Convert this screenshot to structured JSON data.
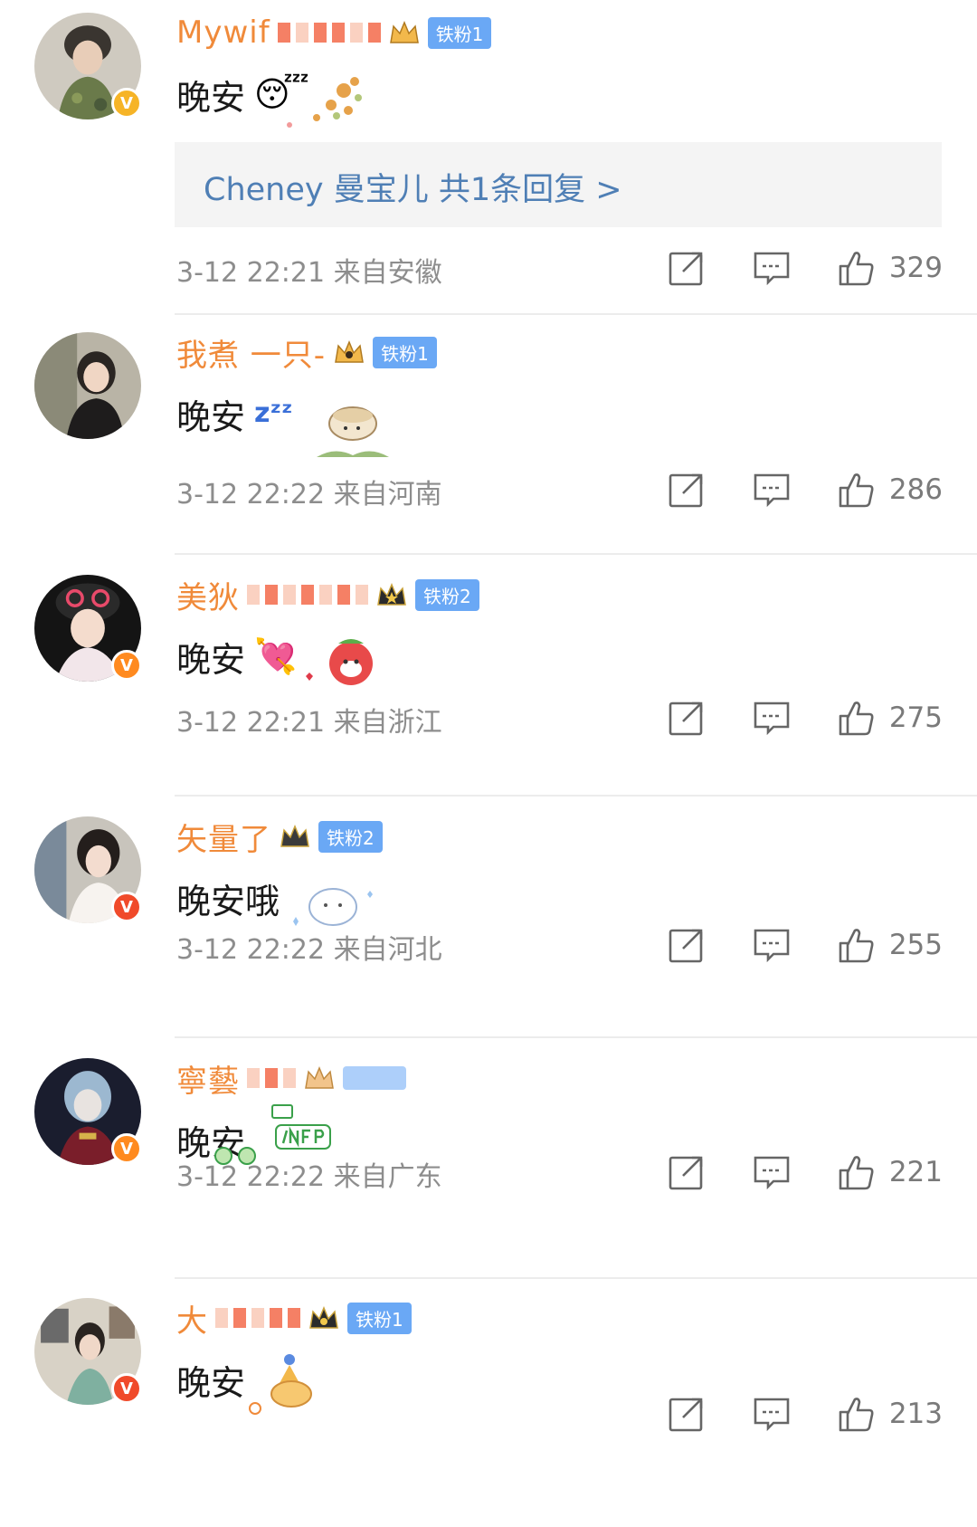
{
  "comments": [
    {
      "name": "Mywif",
      "fan_badge": "铁粉1",
      "text": "晚安",
      "emoji": "😴",
      "verify_color": "#f6b427",
      "replies": "Cheney 曼宝儿  共1条回复 >",
      "time": "3-12 22:21",
      "location": "来自安徽",
      "likes": "329"
    },
    {
      "name": "我煮 一只-",
      "fan_badge": "铁粉1",
      "text": "晚安",
      "emoji": "zᶻᶻ",
      "verify_color": "",
      "time": "3-12 22:22",
      "location": "来自河南",
      "likes": "286"
    },
    {
      "name": "美狄",
      "fan_badge": "铁粉2",
      "text": "晚安",
      "emoji": "💘",
      "verify_color": "#ff8a1f",
      "time": "3-12 22:21",
      "location": "来自浙江",
      "likes": "275"
    },
    {
      "name": "矢量了",
      "fan_badge": "铁粉2",
      "text": "晚安哦",
      "emoji": "",
      "verify_color": "#f04a2a",
      "time": "3-12 22:22",
      "location": "来自河北",
      "likes": "255"
    },
    {
      "name": "寧藝",
      "fan_badge": "",
      "text": "晚安",
      "emoji": "",
      "verify_color": "#ff8a1f",
      "time": "3-12 22:22",
      "location": "来自广东",
      "likes": "221"
    },
    {
      "name": "大",
      "fan_badge": "铁粉1",
      "text": "晚安",
      "emoji": "",
      "verify_color": "#f04a2a",
      "time": "",
      "location": "",
      "likes": "213"
    }
  ],
  "icons": {
    "share": "share-icon",
    "comment": "comment-icon",
    "like": "like-icon",
    "verified": "verified-v-icon"
  }
}
